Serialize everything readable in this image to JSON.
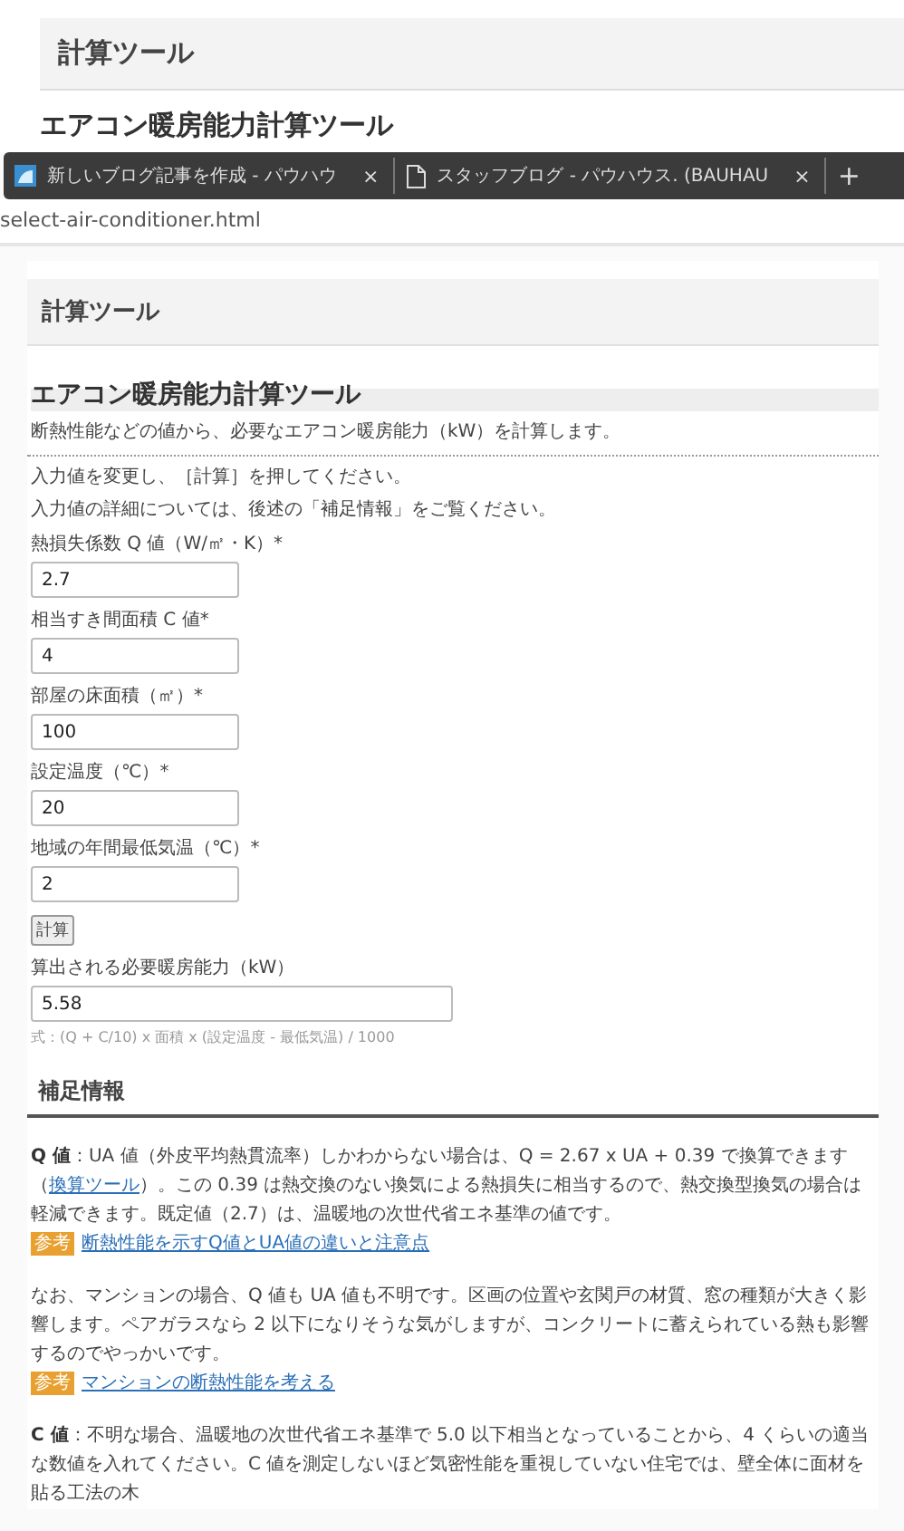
{
  "background_page": {
    "header": "計算ツール",
    "heading": "エアコン暖房能力計算ツール"
  },
  "browser": {
    "tabs": [
      {
        "kind": "app",
        "title": "新しいブログ記事を作成 - パウハウ",
        "close": "×"
      },
      {
        "kind": "page",
        "title": "スタッフブログ - パウハウス. (BAUHAU",
        "close": "×"
      }
    ],
    "new_tab": "+",
    "address": "select-air-conditioner.html"
  },
  "tool": {
    "header": "計算ツール",
    "title": "エアコン暖房能力計算ツール",
    "description": "断熱性能などの値から、必要なエアコン暖房能力（kW）を計算します。",
    "instructions": [
      "入力値を変更し、［計算］を押してください。",
      "入力値の詳細については、後述の「補足情報」をご覧ください。"
    ],
    "fields": [
      {
        "label": "熱損失係数 Q 値（W/㎡・K）*",
        "value": "2.7"
      },
      {
        "label": "相当すき間面積 C 値*",
        "value": "4"
      },
      {
        "label": "部屋の床面積（㎡）*",
        "value": "100"
      },
      {
        "label": "設定温度（℃）*",
        "value": "20"
      },
      {
        "label": "地域の年間最低気温（℃）*",
        "value": "2"
      }
    ],
    "button": "計算",
    "result": {
      "label": "算出される必要暖房能力（kW）",
      "value": "5.58"
    },
    "formula": "式：(Q + C/10) x 面積 x (設定温度 - 最低気温) / 1000"
  },
  "notes": {
    "heading": "補足情報",
    "paragraphs": [
      {
        "segments": [
          {
            "kind": "text",
            "text": "**Q 値**：UA 値（外皮平均熱貫流率）しかわからない場合は、Q = 2.67 x UA + 0.39 で換算できます（"
          },
          {
            "kind": "link",
            "text": "換算ツール"
          },
          {
            "kind": "text",
            "text": "）。この 0.39 は熱交換のない換気による熱損失に相当するので、熱交換型換気の場合は軽減できます。既定値（2.7）は、温暖地の次世代省エネ基準の値です。"
          }
        ],
        "reference": {
          "badge": "参考",
          "link": "断熱性能を示すQ値とUA値の違いと注意点"
        }
      },
      {
        "segments": [
          {
            "kind": "text",
            "text": "なお、マンションの場合、Q 値も UA 値も不明です。区画の位置や玄関戸の材質、窓の種類が大きく影響します。ペアガラスなら 2 以下になりそうな気がしますが、コンクリートに蓄えられている熱も影響するのでやっかいです。"
          }
        ],
        "reference": {
          "badge": "参考",
          "link": "マンションの断熱性能を考える"
        }
      },
      {
        "segments": [
          {
            "kind": "text",
            "text": "**C 値**：不明な場合、温暖地の次世代省エネ基準で 5.0 以下相当となっていることから、4 くらいの適当な数値を入れてください。C 値を測定しないほど気密性能を重視していない住宅では、壁全体に面材を貼る工法の木"
          }
        ]
      }
    ]
  }
}
